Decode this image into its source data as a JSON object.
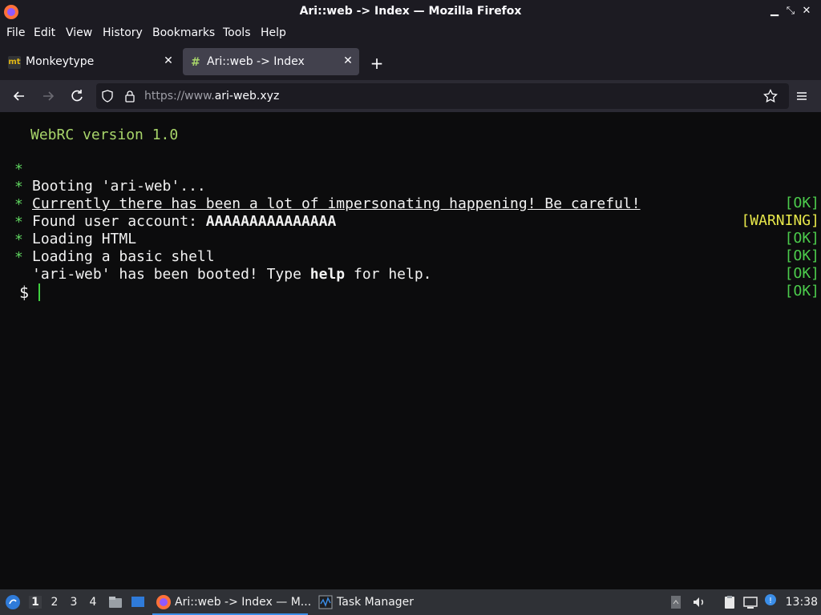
{
  "window": {
    "title": "Ari::web -> Index — Mozilla Firefox"
  },
  "menu": [
    "File",
    "Edit",
    "View",
    "History",
    "Bookmarks",
    "Tools",
    "Help"
  ],
  "tabs": [
    {
      "favicon_text": "mt",
      "label": "Monkeytype",
      "active": false
    },
    {
      "favicon_text": "#",
      "label": "Ari::web -> Index",
      "active": true
    }
  ],
  "address": {
    "prefix": "https://www.",
    "domain": "ari-web.xyz"
  },
  "terminal": {
    "header": "WebRC version 1.0",
    "lines": [
      {
        "bullet": "*",
        "text": "Booting 'ari-web'...",
        "status": "[OK]"
      },
      {
        "bullet": "*",
        "text": "Currently there has been a lot of impersonating happening! Be careful!",
        "status": "[WARNING]"
      },
      {
        "bullet": "*",
        "text_prefix": "Found user account: ",
        "text_bold": "AAAAAAAAAAAAAAA",
        "status": "[OK]"
      },
      {
        "bullet": "*",
        "text": "Loading HTML",
        "status": "[OK]"
      },
      {
        "bullet": "*",
        "text": "Loading a basic shell",
        "status": "[OK]"
      },
      {
        "bullet": "*",
        "text_prefix": "'ari-web' has been booted! Type ",
        "text_bold": "help",
        "text_suffix": " for help.",
        "status": "[OK]"
      }
    ],
    "prompt": "$"
  },
  "taskbar": {
    "workspaces": [
      "1",
      "2",
      "3",
      "4"
    ],
    "tasks": [
      {
        "label": "Ari::web -> Index — M...",
        "active": true
      },
      {
        "label": "Task Manager",
        "active": false
      }
    ],
    "clock": "13:38"
  },
  "colors": {
    "ok": "#4ccc4c",
    "warning": "#e8e84a",
    "bullet": "#5fd35f",
    "header": "#a8d56a"
  }
}
